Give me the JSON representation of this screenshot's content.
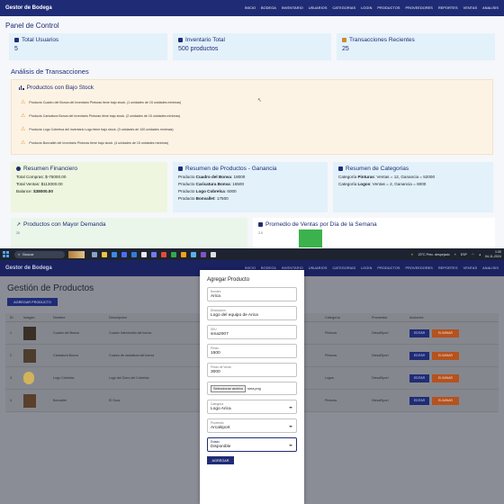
{
  "top": {
    "brand": "Gestor de Bodega",
    "nav": [
      "INICIO",
      "BODEGA",
      "INVENTARIO",
      "USUARIOS",
      "CATEGORIAS",
      "LOGIN",
      "PRODUCTOS",
      "PROVEEDORES",
      "REPORTES",
      "VENTAS",
      "ANALISIS"
    ],
    "page_title": "Panel de Control",
    "cards": [
      {
        "title": "Total Usuarios",
        "value": "5"
      },
      {
        "title": "Inventario Total",
        "value": "500 productos"
      },
      {
        "title": "Transacciones Recientes",
        "value": "25"
      }
    ],
    "analysis_title": "Análisis de Transacciones",
    "low_stock": {
      "title": "Productos con Bajo Stock",
      "alerts": [
        "Producto Cuadro del Bonva del inventario Pinturas tiene bajo stock. (1 unidades de 15 unidades mínimas)",
        "Producto Caricatura Bonva del inventario Pinturas tiene bajo stock. (2 unidades de 15 unidades mínimas)",
        "Producto Logo Cobrelca del inventario Logo tiene bajo stock. (3 unidades de 100 unidades mínimas)",
        "Producto Bonvallet del inventario Pinturas tiene bajo stock. (4 unidades de 15 unidades mínimas)"
      ]
    },
    "financial": {
      "title": "Resumen Financiero",
      "compras": "Total Compras: $-75000.00",
      "ventas": "Total Ventas: $113000.00",
      "balance_label": "Balance:",
      "balance_value": "$38000.00"
    },
    "products_gain": {
      "title": "Resumen de Productos - Ganancia",
      "rows": [
        {
          "label": "Producto",
          "name": "Cuadro del Bonva",
          "value": ": 18000"
        },
        {
          "label": "Producto",
          "name": "Caricatura Bonva",
          "value": ": 16500"
        },
        {
          "label": "Producto",
          "name": "Logo Cobrelca",
          "value": ": 6000"
        },
        {
          "label": "Producto",
          "name": "Bonvallet",
          "value": ": 17500"
        }
      ]
    },
    "categories": {
      "title": "Resumen de Categorias",
      "rows": [
        {
          "label": "Categoría",
          "name": "Pinturas",
          "value": ": Ventas = 12, Ganancia = 52000"
        },
        {
          "label": "Categoría",
          "name": "Logos",
          "value": ": Ventas = 2, Ganancia = 6000"
        }
      ]
    },
    "demand_title": "Productos con Mayor Demanda",
    "demand_axis": "20",
    "avg_title": "Promedio de Ventas por Día de la Semana",
    "avg_axis": "2.0"
  },
  "taskbar": {
    "search": "Buscar",
    "weather": "20°C Prec. despejado",
    "lang": "ESP",
    "time": "1:30",
    "date": "04-11-2024"
  },
  "bottom": {
    "brand": "Gestor de Bodega",
    "nav": [
      "INICIO",
      "BODEGA",
      "INVENTARIO",
      "USUARIOS",
      "CATEGORIAS",
      "LOGIN",
      "PRODUCTOS",
      "PROVEEDORES",
      "REPORTES",
      "VENTAS",
      "ANALISIS"
    ],
    "title": "Gestión de Productos",
    "add_button": "AGREGAR PRODUCTO",
    "headers": [
      "ID",
      "Imagen",
      "Nombre",
      "Descripción",
      "Categoría",
      "Proveedor",
      "Acciones"
    ],
    "rows": [
      {
        "id": "1",
        "name": "Cuadro del Bonva",
        "desc": "Cuadro Intervenido del bonva",
        "cat": "Pinturas",
        "prov": "DiesalSport"
      },
      {
        "id": "2",
        "name": "Caricatura Bonva",
        "desc": "Cuadro de caricatura del bonva",
        "cat": "Pinturas",
        "prov": "DiesalSport"
      },
      {
        "id": "3",
        "name": "Logo Cobrelca",
        "desc": "Logo del Zorro del Cobrelca",
        "cat": "Logos",
        "prov": "DiesalSport"
      },
      {
        "id": "4",
        "name": "Bonvallet",
        "desc": "El Gura",
        "cat": "Pinturas",
        "prov": "DiesalSport"
      }
    ],
    "edit_label": "EDITAR",
    "delete_label": "ELIMINAR",
    "modal": {
      "title": "Agregar Producto",
      "fields": [
        {
          "label": "Nombre",
          "value": "Arica"
        },
        {
          "label": "Descripción",
          "value": "Logo del equipo de Arica"
        },
        {
          "label": "SKU",
          "value": "sma2007"
        },
        {
          "label": "Precio",
          "value": "1500"
        },
        {
          "label": "Precio de Venta",
          "value": "3000"
        }
      ],
      "file_button": "Seleccionar archivo",
      "file_name": "sma.png",
      "categoria_label": "Categoría",
      "categoria_value": "Logo Arica",
      "proveedor_label": "Proveedor",
      "proveedor_value": "Arcalsport",
      "estado_label": "Estado",
      "estado_value": "Disponible",
      "submit": "AGREGAR"
    }
  },
  "colors": {
    "navy": "#1f2c75",
    "warning": "#e59a2c",
    "danger": "#b5521e",
    "success": "#198d2a"
  }
}
